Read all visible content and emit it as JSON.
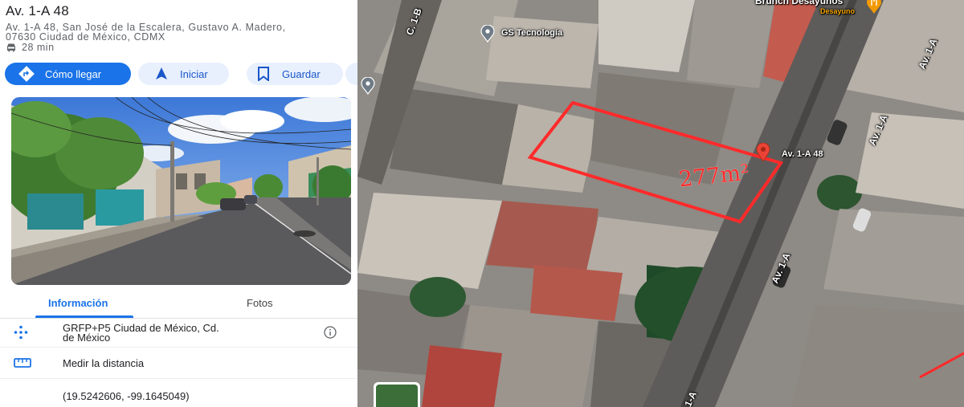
{
  "place": {
    "title": "Av. 1-A 48",
    "address_line1": "Av. 1-A 48, San José de la Escalera, Gustavo A. Madero,",
    "address_line2": "07630 Ciudad de México, CDMX",
    "drive_time": "28 min",
    "drive_icon": "car-icon"
  },
  "actions": {
    "directions": "Cómo llegar",
    "start": "Iniciar",
    "save": "Guardar"
  },
  "tabs": {
    "info": "Información",
    "photos": "Fotos"
  },
  "details": {
    "plus_code_line1": "GRFP+P5 Ciudad de México, Cd.",
    "plus_code_line2": "de México",
    "measure": "Medir la distancia",
    "coordinates": "(19.5242606, -99.1645049)"
  },
  "map": {
    "pins": {
      "place": "Av. 1-A 48",
      "business": "GS Tecnología",
      "restaurant_top": "Brunch Desayunos",
      "restaurant_sub": "Desayuno"
    },
    "streets": {
      "c1b": "C. 1-B",
      "av1a_upper": "Av. 1-A",
      "av1a_mid": "Av. 1-A",
      "av1a_center": "Av. 1-A",
      "av1a_bottom": "1-A"
    },
    "annotation": "277m²"
  },
  "colors": {
    "accent": "#1a73e8",
    "chip_bg": "#e8f0fe",
    "marker_red": "#ea4335",
    "annotation_red": "#ff2a2a"
  }
}
